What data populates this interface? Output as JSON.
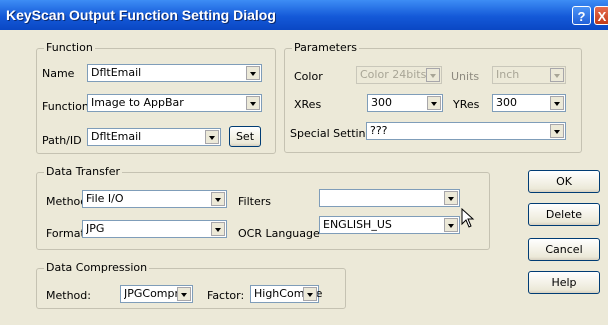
{
  "window": {
    "title": "KeyScan Output Function Setting Dialog",
    "help_glyph": "?",
    "close_glyph": "X"
  },
  "function_group": {
    "legend": "Function",
    "name_label": "Name",
    "name_value": "DfltEmail",
    "function_label": "Function",
    "function_value": "Image to AppBar",
    "pathid_label": "Path/ID",
    "pathid_value": "DfltEmail",
    "set_button": "Set"
  },
  "parameters_group": {
    "legend": "Parameters",
    "color_label": "Color",
    "color_value": "Color 24bits",
    "units_label": "Units",
    "units_value": "Inch",
    "xres_label": "XRes",
    "xres_value": "300",
    "yres_label": "YRes",
    "yres_value": "300",
    "special_label": "Special Settings",
    "special_value": "???"
  },
  "data_transfer_group": {
    "legend": "Data Transfer",
    "method_label": "Method",
    "method_value": "File I/O",
    "filters_label": "Filters",
    "filters_value": "",
    "format_label": "Format",
    "format_value": "JPG",
    "ocr_label": "OCR Language",
    "ocr_value": "ENGLISH_US"
  },
  "data_compression_group": {
    "legend": "Data Compression",
    "method_label": "Method:",
    "method_value": "JPGComprs",
    "factor_label": "Factor:",
    "factor_value": "HighCompre"
  },
  "buttons": {
    "ok": "OK",
    "delete": "Delete",
    "cancel": "Cancel",
    "help": "Help"
  },
  "icons": {
    "cursor": "arrow-cursor-icon"
  }
}
